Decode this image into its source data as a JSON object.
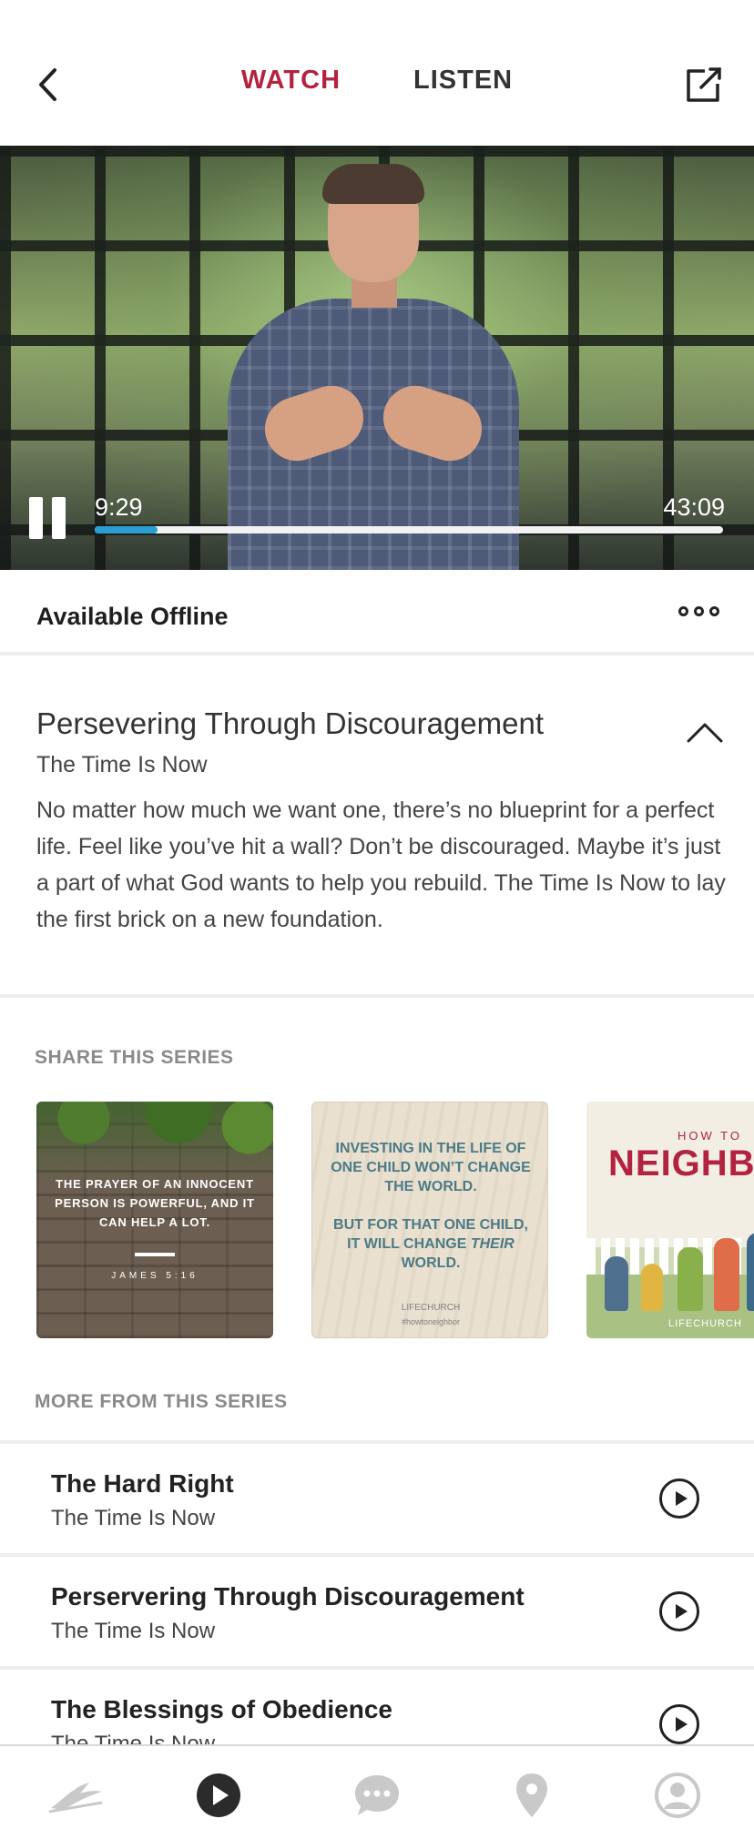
{
  "header": {
    "tabs": [
      {
        "label": "WATCH",
        "active": true
      },
      {
        "label": "LISTEN",
        "active": false
      }
    ],
    "icons": {
      "back": "chevron-left-icon",
      "share": "external-share-icon"
    }
  },
  "player": {
    "current_time": "9:29",
    "total_time": "43:09",
    "progress": 0.1,
    "state": "playing",
    "accent_color": "#2b9fd3"
  },
  "offline": {
    "label": "Available Offline",
    "menu_icon": "more-options-icon"
  },
  "episode": {
    "title": "Persevering Through Discouragement",
    "series": "The Time Is Now",
    "description": "No matter how much we want one, there’s no blueprint for a perfect life. Feel like you’ve hit a wall? Don’t be discouraged. Maybe it’s just a part of what God wants to help you rebuild. The Time Is Now to lay the first brick on a new foundation."
  },
  "share_section": {
    "label": "SHARE THIS SERIES",
    "cards": [
      {
        "quote": "THE PRAYER OF AN INNOCENT PERSON IS POWERFUL, AND IT CAN HELP A LOT.",
        "reference": "JAMES 5:16"
      },
      {
        "line1": "INVESTING IN THE LIFE OF ONE CHILD WON’T CHANGE THE WORLD.",
        "line2a": "BUT FOR THAT ONE CHILD, IT WILL CHANGE",
        "line2b": "THEIR",
        "line2c": "WORLD.",
        "brand": "LIFECHURCH",
        "hashtag": "#howtoneighbor"
      },
      {
        "small": "HOW TO",
        "big": "NEIGHBO",
        "brand": "LIFECHURCH"
      }
    ]
  },
  "more_section": {
    "label": "MORE FROM THIS SERIES",
    "items": [
      {
        "title": "The Hard Right",
        "series": "The Time Is Now"
      },
      {
        "title": "Perservering Through Discouragement",
        "series": "The Time Is Now"
      },
      {
        "title": "The Blessings of Obedience",
        "series": "The Time Is Now"
      }
    ]
  },
  "tab_bar": {
    "items": [
      {
        "icon": "lifechurch-logo-icon",
        "active": false
      },
      {
        "icon": "play-circle-icon",
        "active": true
      },
      {
        "icon": "chat-bubble-icon",
        "active": false
      },
      {
        "icon": "location-pin-icon",
        "active": false
      },
      {
        "icon": "profile-icon",
        "active": false
      }
    ],
    "active_color": "#2b2b2b",
    "inactive_color": "#c9c9c9"
  },
  "colors": {
    "brand_red": "#b3233f",
    "divider": "#eeeeee"
  }
}
